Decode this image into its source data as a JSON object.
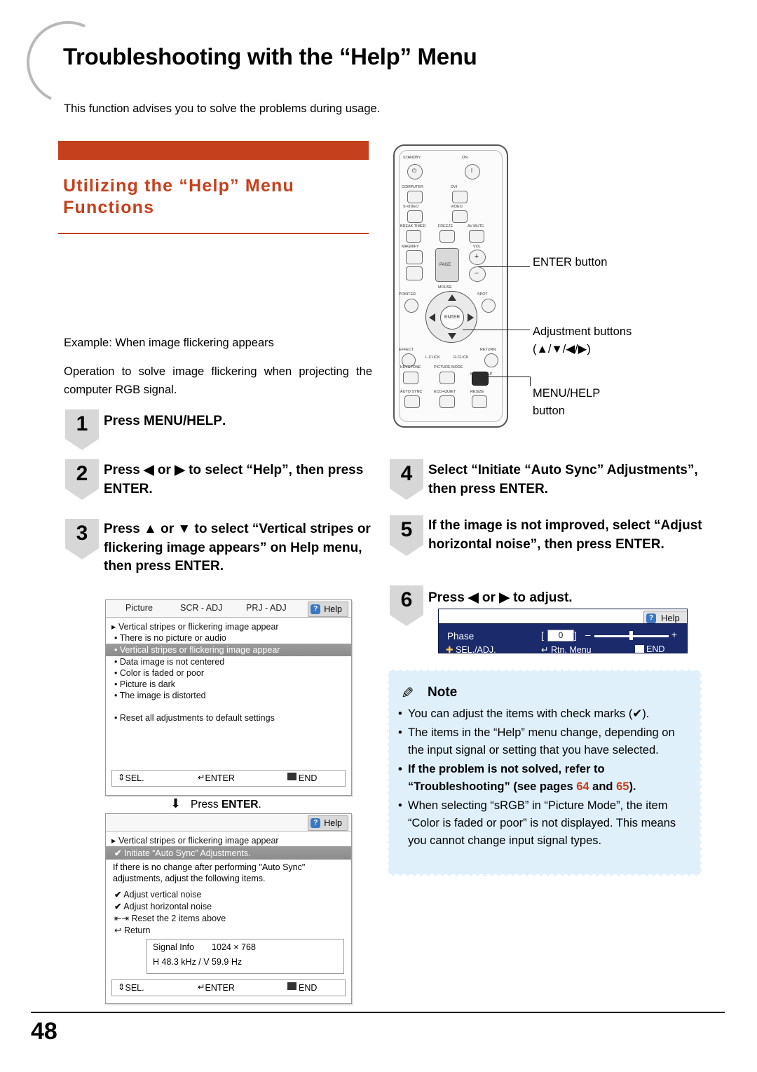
{
  "page": {
    "title": "Troubleshooting with the “Help” Menu",
    "intro": "This function advises you to solve the problems during usage.",
    "section_title": "Utilizing the “Help” Menu Functions",
    "example_line": "Example: When image flickering appears",
    "operation_line": "Operation to solve image flickering when projecting the computer RGB signal.",
    "folio": "48"
  },
  "steps": [
    {
      "num": "1",
      "text": "Press MENU/HELP."
    },
    {
      "num": "2",
      "text": "Press ◀ or ▶ to select “Help”, then press ENTER."
    },
    {
      "num": "3",
      "text": "Press ▲ or ▼ to select “Vertical stripes or flickering image appears” on Help menu, then press ENTER."
    },
    {
      "num": "4",
      "text": "Select “Initiate “Auto Sync” Adjustments”, then press ENTER."
    },
    {
      "num": "5",
      "text": "If the image is not improved, select “Adjust horizontal noise”, then press ENTER."
    },
    {
      "num": "6",
      "text": "Press ◀ or ▶ to adjust."
    }
  ],
  "remote": {
    "top_labels": [
      "STANDBY",
      "ON"
    ],
    "rows": [
      [
        "COMPUTER",
        "DVI"
      ],
      [
        "S-VIDEO",
        "VIDEO"
      ],
      [
        "BREAK TIMER",
        "FREEZE",
        "AV MUTE"
      ],
      [
        "MAGNIFY",
        "PAGE",
        "VOL"
      ],
      [
        "MOUSE"
      ],
      [
        "POINTER",
        "SPOT"
      ],
      [
        "EFFECT",
        "L-CLICK",
        "R-CLICK",
        "RETURN"
      ],
      [
        "KEYSTONE",
        "PICTURE MODE",
        "MENU/HELP"
      ],
      [
        "AUTO SYNC",
        "ECO+QUIET",
        "RESIZE"
      ]
    ],
    "enter_label": "ENTER"
  },
  "callouts": [
    {
      "label": "ENTER button"
    },
    {
      "label": "Adjustment buttons",
      "sub": "(▲/▼/◀/▶)"
    },
    {
      "label": "MENU/HELP",
      "sub": "button"
    }
  ],
  "osd_help_menu": {
    "tabs": [
      "Picture",
      "SCR - ADJ",
      "PRJ - ADJ"
    ],
    "help_tab": "Help",
    "heading": "Vertical stripes or flickering image appear",
    "items": [
      "There is no picture or audio",
      "Vertical stripes or flickering image appear",
      "Data image is not centered",
      "Color is faded or poor",
      "Picture is dark",
      "The image is distorted"
    ],
    "selected_index": 1,
    "reset_item": "Reset all adjustments to default settings",
    "footer": {
      "sel": "SEL.",
      "enter": "ENTER",
      "end": "END"
    }
  },
  "press_enter_label": "Press ENTER.",
  "osd_autosync": {
    "help_tab": "Help",
    "heading": "Vertical stripes or flickering image appear",
    "selected_item": "Initiate “Auto Sync” Adjustments.",
    "description": "If there is no change after performing \"Auto Sync\" adjustments, adjust the following items.",
    "items": [
      "Adjust vertical noise",
      "Adjust horizontal noise",
      "Reset the 2 items above",
      "Return"
    ],
    "signal_info_label": "Signal Info",
    "signal_resolution": "1024 × 768",
    "signal_freq": "H      48.3  kHz  /  V   59.9  Hz",
    "footer": {
      "sel": "SEL.",
      "enter": "ENTER",
      "end": "END"
    }
  },
  "osd_phase": {
    "help_tab": "Help",
    "label": "Phase",
    "bracket_left": "[",
    "value": "0",
    "bracket_right": "]",
    "minus": "–",
    "plus": "+",
    "footer_sel": "SEL./ADJ.",
    "footer_rtn": "Rtn. Menu",
    "footer_end": "END"
  },
  "note": {
    "title": "Note",
    "items": [
      {
        "text": "You can adjust the items with check marks (✔).",
        "bold": false
      },
      {
        "text": "The items in the “Help” menu change, depending on the input signal or setting that you have selected.",
        "bold": false
      },
      {
        "text": "If the problem is not solved, refer to “Troubleshooting” (see pages 64 and 65).",
        "bold": true,
        "links": [
          "64",
          "65"
        ]
      },
      {
        "text": "When selecting “sRGB” in “Picture Mode”, the item “Color is faded or poor” is not displayed. This means you cannot change input signal types.",
        "bold": false
      }
    ]
  },
  "colors": {
    "accent": "#c5401c",
    "note_bg": "#dff0fb",
    "osd_blue": "#1b2a6b"
  }
}
